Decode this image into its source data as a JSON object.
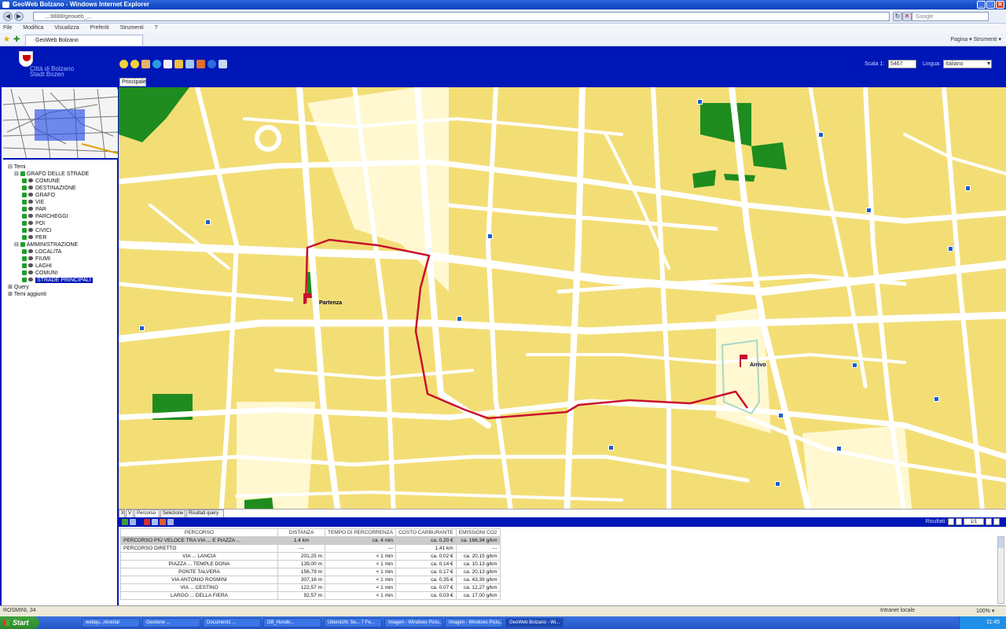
{
  "window": {
    "title": "GeoWeb Bolzano - Windows Internet Explorer",
    "minimize": "_",
    "maximize": "□",
    "close": "✕"
  },
  "browser": {
    "address": "...:8888/geoweb_...",
    "search_placeholder": "Google",
    "menu": [
      "File",
      "Modifica",
      "Visualizza",
      "Preferiti",
      "Strumenti",
      "?"
    ],
    "tab_title": "GeoWeb Bolzano",
    "tools_right": "Pagina ▾  Strumenti ▾"
  },
  "app": {
    "logo_line1": "Città di Bolzano",
    "logo_line2": "Stadt Bozen",
    "scale_label": "Scala 1:",
    "scale_value": "5467",
    "language_label": "Lingua:",
    "language_value": "Italiano",
    "map_tab": "Principale"
  },
  "tree": {
    "root": "Temi",
    "group1": "GRAFO DELLE STRADE",
    "group1_items": [
      "COMUNE",
      "DESTINAZIONE",
      "GRAFO",
      "VIE",
      "PAR",
      "PARCHEGGI",
      "POI",
      "CIVICI",
      "PER"
    ],
    "group2": "AMMINISTRAZIONE",
    "group2_items": [
      "LOCALITA",
      "FIUMI",
      "LAGHI",
      "COMUNI",
      "STRADE PRINCIPALI"
    ],
    "query": "Query",
    "extra": "Temi aggiunti"
  },
  "map": {
    "start_label": "Partenza",
    "end_label": "Arrivo"
  },
  "bottom_tabs": [
    "X",
    "V",
    "Percorso",
    "Selezione",
    "Risultati query"
  ],
  "results": {
    "label": "Risultati: 1",
    "page": "1/1"
  },
  "table": {
    "headers": [
      "PERCORSO",
      "DISTANZA",
      "TEMPO DI PERCORRENZA",
      "COSTO CARBURANTE",
      "EMISSIONI CO2"
    ],
    "rows": [
      [
        "PERCORSO PIÙ VELOCE TRA VIA ... E PIAZZA ...",
        "1,4 km",
        "ca. 4 min",
        "ca. 0,20 €",
        "ca. 166,34 g/km"
      ],
      [
        "PERCORSO DIRETTO",
        "---",
        "---",
        "1,41 km",
        "---"
      ],
      [
        "VIA ... LANCIA",
        "201,25 m",
        "< 1 min",
        "ca. 0,02 €",
        "ca. 20,15 g/km"
      ],
      [
        "PIAZZA ... TEMPLE DONA",
        "139,00 m",
        "< 1 min",
        "ca. 0,14 €",
        "ca. 10,13 g/km"
      ],
      [
        "PONTE TALVERA",
        "156,79 m",
        "< 1 min",
        "ca. 0,17 €",
        "ca. 20,13 g/km"
      ],
      [
        "VIA ANTONIO ROSMINI",
        "307,16 m",
        "< 1 min",
        "ca. 0,35 €",
        "ca. 43,39 g/km"
      ],
      [
        "VIA ... CESTINO",
        "122,57 m",
        "< 1 min",
        "ca. 0,07 €",
        "ca. 12,27 g/km"
      ],
      [
        "LARGO ... DELLA FIERA",
        "92,57 m",
        "< 1 min",
        "ca. 0,03 €",
        "ca. 17,00 g/km"
      ]
    ]
  },
  "statusbar": {
    "left": "ROSMINI, 34",
    "right": "Intranet locale",
    "zoom": "100% ▾"
  },
  "taskbar": {
    "start": "Start",
    "items": [
      "webqu...ntrotrial",
      "Gestione ...",
      "Document1 ...",
      "DB_Hunde...",
      "Ubersicht: Se... 7 Fe...",
      "Imagen - Windows Pictu...",
      "Imagen - Windows Pictu...",
      "GeoWeb Bolzano - Wi..."
    ],
    "clock": "11:45"
  }
}
